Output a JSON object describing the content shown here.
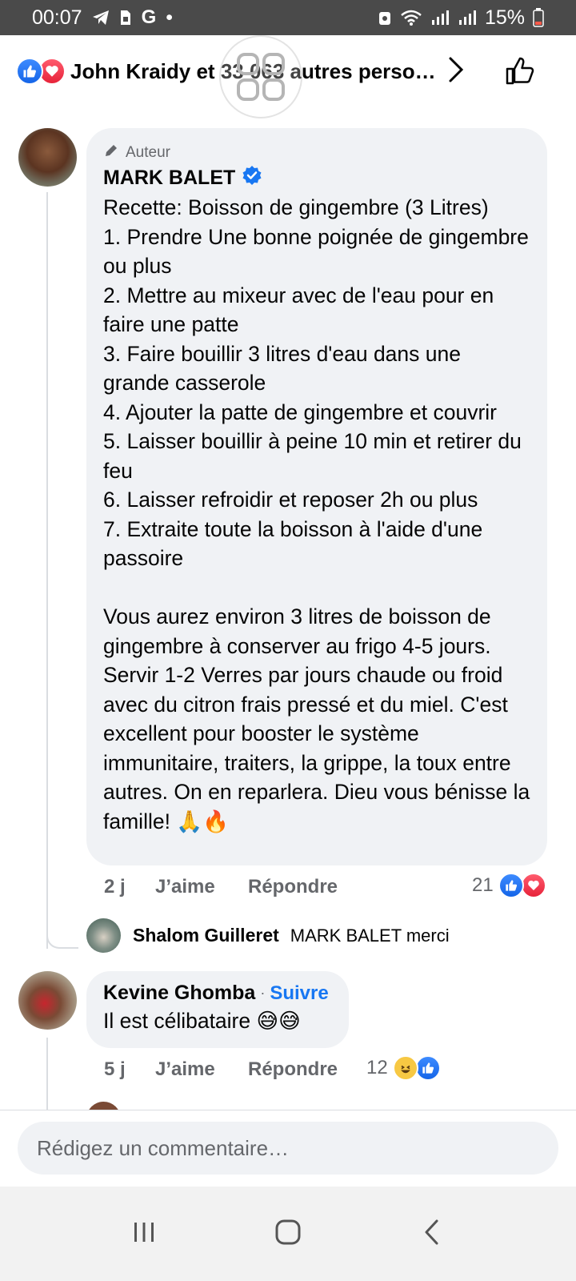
{
  "status_bar": {
    "time": "00:07",
    "battery": "15%"
  },
  "header": {
    "reactors_text": "John Kraidy et 33 063 autres perso…"
  },
  "comments": [
    {
      "author": "MARK BALET",
      "badge": "Auteur",
      "verified": true,
      "text": "Recette: Boisson de gingembre (3 Litres)\n1. Prendre Une bonne poignée de gingembre ou plus\n2. Mettre au mixeur avec de l'eau pour en faire une patte\n3. Faire bouillir 3 litres d'eau dans une grande casserole\n4. Ajouter la patte de gingembre et couvrir\n5. Laisser bouillir à peine 10 min et retirer du feu\n6. Laisser refroidir et reposer 2h ou plus\n7. Extraite toute la boisson à l'aide d'une passoire\n\nVous aurez environ 3 litres de boisson de gingembre à conserver au frigo 4-5 jours. Servir 1-2 Verres par jours chaude ou froid avec du citron frais pressé et du miel. C'est excellent pour booster le système immunitaire, traiters, la grippe, la toux entre autres. On en reparlera. Dieu vous bénisse la famille! ",
      "emojis": "🙏🔥",
      "time": "2 j",
      "like_label": "J’aime",
      "reply_label": "Répondre",
      "reaction_count": "21",
      "reactions": [
        "like",
        "love"
      ]
    },
    {
      "author": "Kevine Ghomba",
      "follow_separator": "·",
      "follow_label": "Suivre",
      "text": "Il est célibataire ",
      "emojis": "😅😅",
      "time": "5 j",
      "like_label": "J’aime",
      "reply_label": "Répondre",
      "reaction_count": "12",
      "reactions": [
        "haha",
        "like"
      ]
    }
  ],
  "reply_preview": {
    "author": "Shalom Guilleret",
    "text": "MARK BALET merci"
  },
  "composer": {
    "placeholder": "Rédigez un commentaire…"
  },
  "colors": {
    "accent": "#1877f2",
    "like": "#1877f2",
    "love": "#f33e58",
    "bubble": "#f0f2f5",
    "muted_text": "#65676b"
  },
  "icons": [
    "telegram-icon",
    "sim-icon",
    "google-icon",
    "wifi-icon",
    "signal-icon",
    "battery-icon",
    "chevron-right-icon",
    "thumbs-up-icon",
    "pencil-icon",
    "verified-icon",
    "recent-apps-icon",
    "home-icon",
    "back-icon"
  ]
}
